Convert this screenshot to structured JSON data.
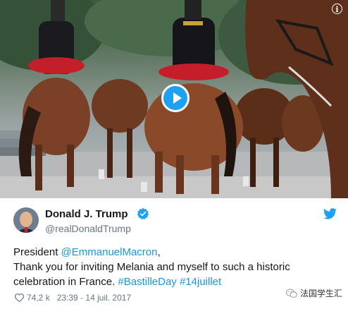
{
  "media": {
    "play_icon": "play-icon",
    "info_icon": "info-icon",
    "info_glyph": "i"
  },
  "tweet": {
    "author_name": "Donald J. Trump",
    "author_handle": "@realDonaldTrump",
    "verified_icon": "verified-badge-icon",
    "brand_icon": "twitter-bird-icon",
    "text_parts": [
      "President ",
      "@EmmanuelMacron",
      ",",
      "Thank you for inviting Melania and myself to such a historic celebration in France. ",
      "#BastilleDay",
      " ",
      "#14juillet"
    ],
    "like_count": "74,2 k",
    "timestamp": "23:39 - 14 juil. 2017"
  },
  "watermark": {
    "text": "法国学生汇"
  },
  "colors": {
    "link": "#1b95e0",
    "brand": "#1da1f2",
    "secondary_text": "#657786"
  }
}
